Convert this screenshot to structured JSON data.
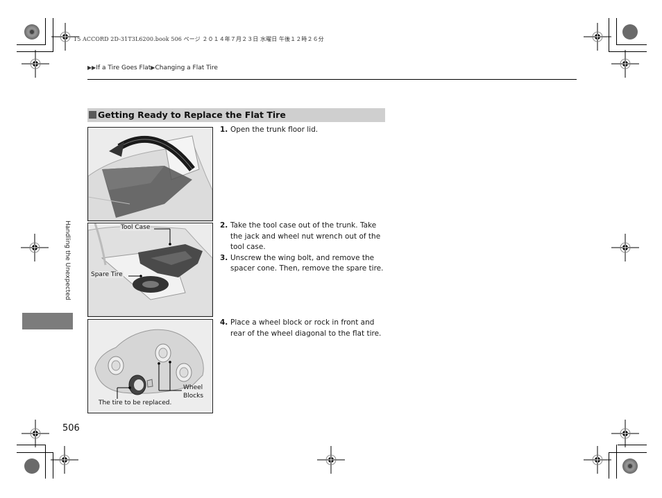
{
  "print_header": {
    "file_info": "15 ACCORD 2D-31T3L6200.book  506 ページ  ２０１４年７月２３日  水曜日  午後１２時２６分"
  },
  "breadcrumb": {
    "separator_icon": "right-triangle-icon",
    "items": [
      "If a Tire Goes Flat",
      "Changing a Flat Tire"
    ]
  },
  "section": {
    "icon": "gray-square-icon",
    "title": "Getting Ready to Replace the Flat Tire"
  },
  "figures": [
    {
      "name": "open-trunk-floor-lid",
      "callouts": []
    },
    {
      "name": "tool-case-and-spare-tire",
      "callouts": [
        "Tool Case",
        "Spare Tire"
      ]
    },
    {
      "name": "wheel-blocks-diagram",
      "callouts": [
        "Wheel",
        "Blocks",
        "The tire to be replaced."
      ]
    }
  ],
  "steps": [
    {
      "num": "1.",
      "text": "Open the trunk floor lid."
    },
    {
      "num": "2.",
      "text": "Take the tool case out of the trunk. Take the jack and wheel nut wrench out of the tool case."
    },
    {
      "num": "3.",
      "text": "Unscrew the wing bolt, and remove the spacer cone. Then, remove the spare tire."
    },
    {
      "num": "4.",
      "text": "Place a wheel block or rock in front and rear of the wheel diagonal to the flat tire."
    }
  ],
  "side_tab": {
    "label": "Handling the Unexpected"
  },
  "page_number": "506",
  "colors": {
    "section_bg": "#cfcfcf",
    "section_square": "#5a5a5a",
    "side_tab": "#7c7c7c",
    "figure_bg": "#e9e9e9"
  }
}
